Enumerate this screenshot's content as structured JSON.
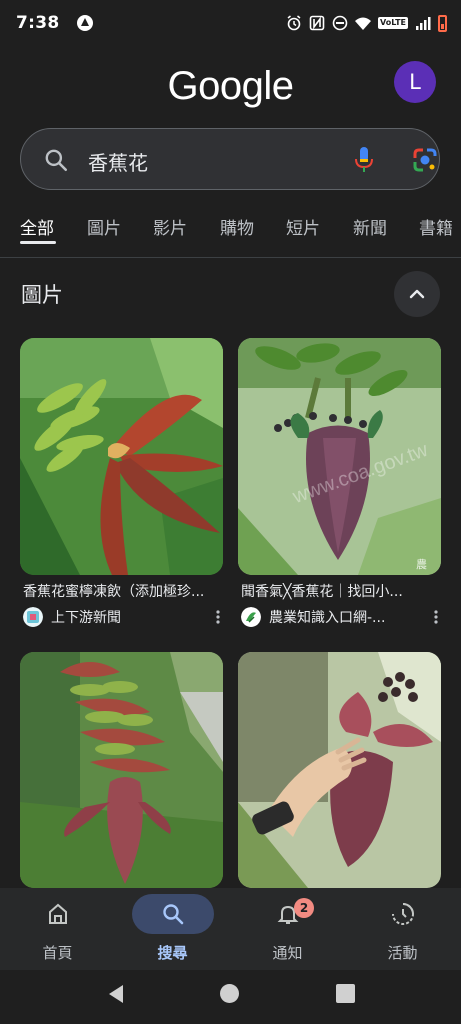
{
  "status_bar": {
    "time": "7:38",
    "volte": "VoLTE",
    "icons": [
      "app-icon",
      "alarm-icon",
      "nfc-icon",
      "dnd-icon",
      "wifi-icon",
      "signal-icon",
      "battery-low-icon"
    ]
  },
  "header": {
    "logo": "Google",
    "avatar_letter": "L",
    "avatar_color": "#5b2fb6"
  },
  "search": {
    "query": "香蕉花",
    "icons": [
      "search-icon",
      "mic-icon",
      "lens-icon"
    ]
  },
  "tabs": [
    {
      "label": "全部",
      "active": true
    },
    {
      "label": "圖片",
      "active": false
    },
    {
      "label": "影片",
      "active": false
    },
    {
      "label": "購物",
      "active": false
    },
    {
      "label": "短片",
      "active": false
    },
    {
      "label": "新聞",
      "active": false
    },
    {
      "label": "書籍",
      "active": false
    }
  ],
  "images_section": {
    "title": "圖片",
    "results": [
      {
        "caption": "香蕉花蜜檸凍飲（添加極珍...",
        "source": "上下游新聞",
        "favicon_color": "#6cc4d8"
      },
      {
        "caption": "聞香氣╳香蕉花｜找回小...",
        "source": "農業知識入口網-...",
        "favicon_color": "#ffffff",
        "watermark": "www.coa.gov.tw",
        "watermark_badge": "農"
      },
      {
        "caption": "",
        "source": ""
      },
      {
        "caption": "",
        "source": ""
      }
    ]
  },
  "bottom_nav": [
    {
      "label": "首頁",
      "icon": "home-icon",
      "active": false
    },
    {
      "label": "搜尋",
      "icon": "search-icon",
      "active": true
    },
    {
      "label": "通知",
      "icon": "bell-icon",
      "active": false,
      "badge": "2"
    },
    {
      "label": "活動",
      "icon": "activity-icon",
      "active": false
    }
  ],
  "colors": {
    "background": "#1f1f1f",
    "search_box": "#303134",
    "accent": "#a8c7fa",
    "badge": "#f28b82"
  }
}
